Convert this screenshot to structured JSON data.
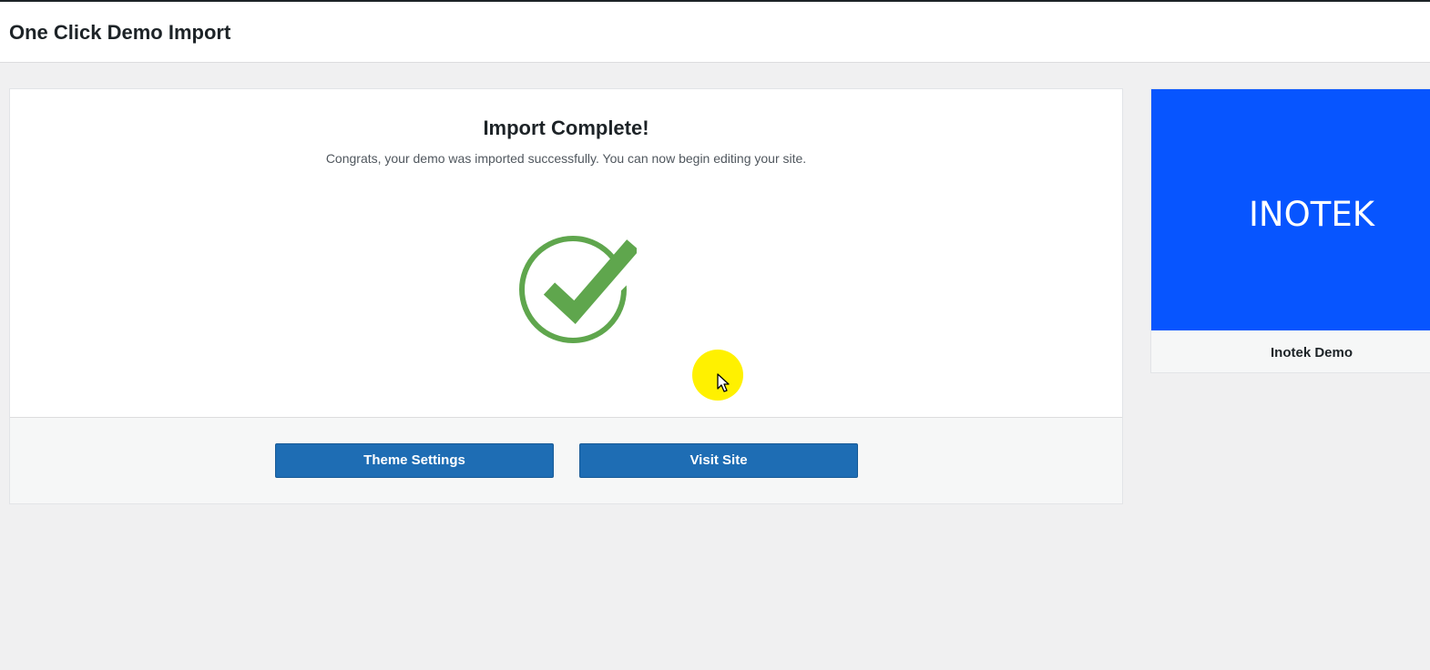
{
  "header": {
    "title": "One Click Demo Import"
  },
  "import_result": {
    "heading": "Import Complete!",
    "message": "Congrats, your demo was imported successfully. You can now begin editing your site.",
    "icon": "success-checkmark-icon",
    "icon_color": "#5fa64d"
  },
  "actions": {
    "theme_settings_label": "Theme Settings",
    "visit_site_label": "Visit Site",
    "button_color": "#1e6db4"
  },
  "demo": {
    "logo_text": "INOTEK",
    "name": "Inotek Demo",
    "thumbnail_color": "#0755ff"
  },
  "cursor": {
    "highlight_color": "#fff100"
  }
}
